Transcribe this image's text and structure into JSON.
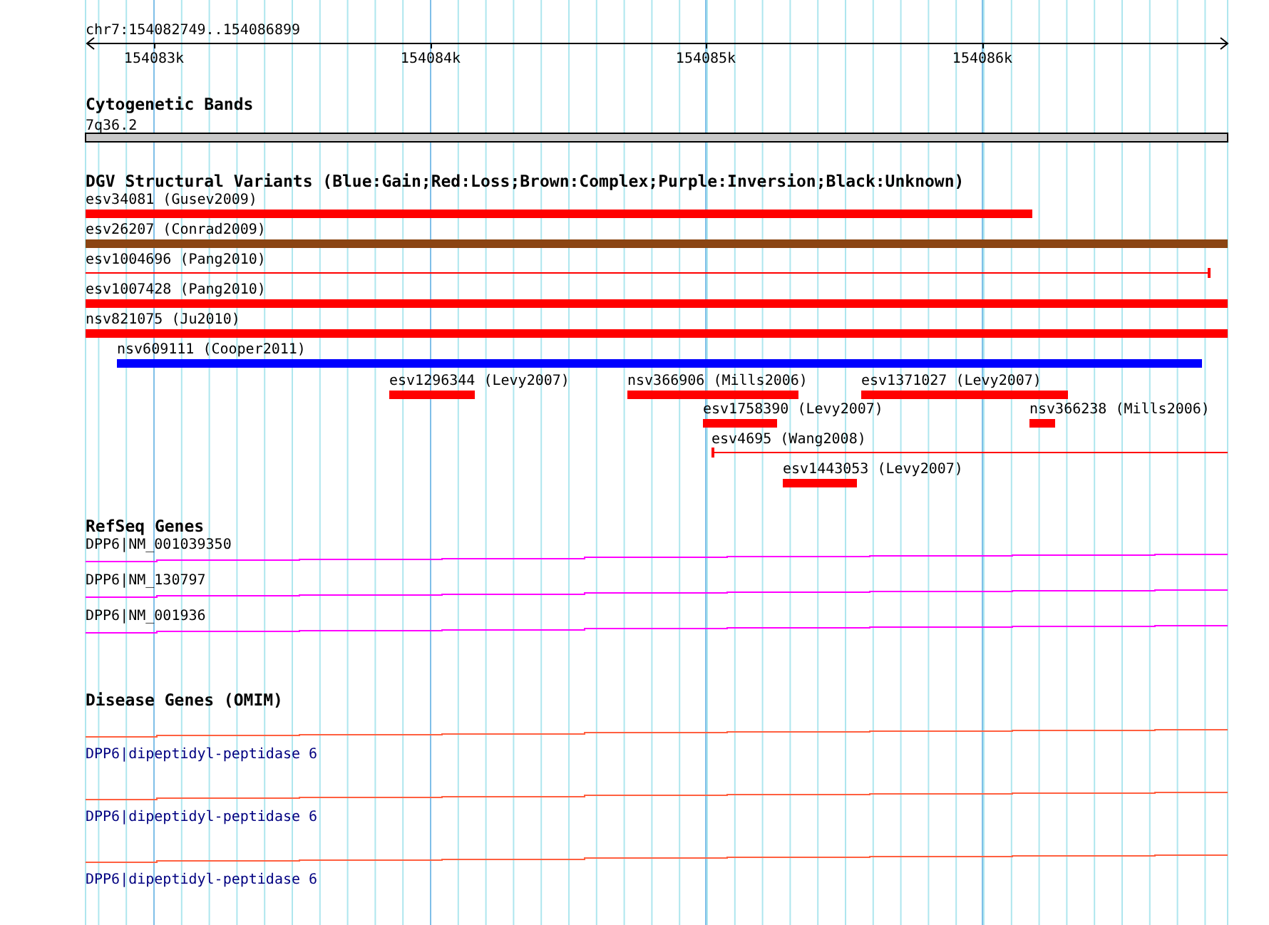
{
  "ruler": {
    "label": "chr7:154082749..154086899",
    "ticks": [
      "154083k",
      "154084k",
      "154085k",
      "154086k"
    ]
  },
  "tracks": [
    {
      "title": "Cytogenetic Bands",
      "kind": "band",
      "features": [
        {
          "label": "7q36.2"
        }
      ]
    },
    {
      "title": "DGV Structural Variants (Blue:Gain;Red:Loss;Brown:Complex;Purple:Inversion;Black:Unknown)",
      "kind": "variant",
      "features": [
        {
          "label": "esv34081 (Gusev2009)",
          "kind": "bar",
          "color": "#ff0000"
        },
        {
          "label": "esv26207 (Conrad2009)",
          "kind": "bar",
          "color": "#8b4513"
        },
        {
          "label": "esv1004696 (Pang2010)",
          "kind": "line",
          "color": "#ff0000"
        },
        {
          "label": "esv1007428 (Pang2010)",
          "kind": "bar",
          "color": "#ff0000"
        },
        {
          "label": "nsv821075 (Ju2010)",
          "kind": "bar",
          "color": "#ff0000"
        },
        {
          "label": "nsv609111 (Cooper2011)",
          "kind": "bar",
          "color": "#0000ff"
        },
        {
          "label": "esv1296344 (Levy2007)",
          "kind": "bar",
          "color": "#ff0000"
        },
        {
          "label": "nsv366906 (Mills2006)",
          "kind": "bar",
          "color": "#ff0000"
        },
        {
          "label": "esv1371027 (Levy2007)",
          "kind": "bar",
          "color": "#ff0000"
        },
        {
          "label": "esv1758390 (Levy2007)",
          "kind": "bar",
          "color": "#ff0000"
        },
        {
          "label": "nsv366238 (Mills2006)",
          "kind": "bar",
          "color": "#ff0000"
        },
        {
          "label": "esv4695 (Wang2008)",
          "kind": "line",
          "color": "#ff0000"
        },
        {
          "label": "esv1443053 (Levy2007)",
          "kind": "bar",
          "color": "#ff0000"
        }
      ]
    },
    {
      "title": "RefSeq Genes",
      "kind": "gene",
      "features": [
        {
          "label": "DPP6|NM_001039350"
        },
        {
          "label": "DPP6|NM_130797"
        },
        {
          "label": "DPP6|NM_001936"
        }
      ]
    },
    {
      "title": "Disease Genes (OMIM)",
      "kind": "disease",
      "features": [
        {
          "label": "DPP6|dipeptidyl-peptidase 6"
        },
        {
          "label": "DPP6|dipeptidyl-peptidase 6"
        },
        {
          "label": "DPP6|dipeptidyl-peptidase 6"
        }
      ]
    }
  ]
}
